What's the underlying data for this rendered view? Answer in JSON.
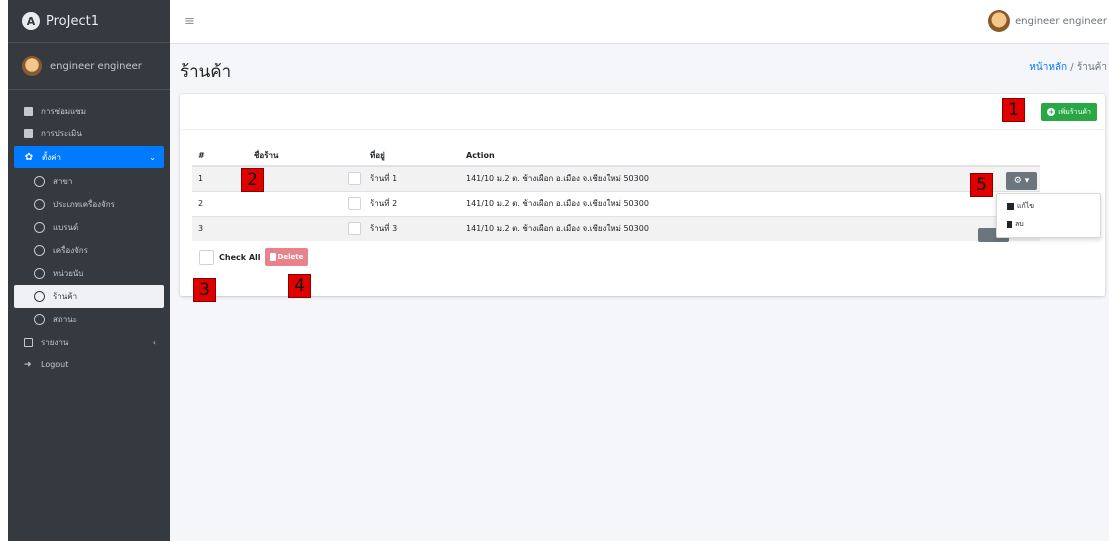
{
  "brand": {
    "name": "ProJect1",
    "logo_letter": "A"
  },
  "user": {
    "name": "engineer engineer"
  },
  "sidebar": {
    "items": [
      {
        "label": "การซ่อมแซม",
        "icon": "clipboard-icon"
      },
      {
        "label": "การประเมิน",
        "icon": "check-square-icon"
      }
    ],
    "active": {
      "label": "ตั้งค่า",
      "icon": "gear-icon",
      "chevron": "⌄"
    },
    "sub_items": [
      {
        "label": "สาขา"
      },
      {
        "label": "ประเภทเครื่องจักร"
      },
      {
        "label": "แบรนด์"
      },
      {
        "label": "เครื่องจักร"
      },
      {
        "label": "หน่วยนับ"
      },
      {
        "label": "ร้านค้า",
        "selected": true
      },
      {
        "label": "สถานะ"
      }
    ],
    "report": {
      "label": "รายงาน",
      "icon": "report-icon",
      "chevron": "‹"
    },
    "logout": {
      "label": "Logout",
      "icon": "logout-icon"
    }
  },
  "topbar": {
    "hamburger": "≡",
    "user_name": "engineer engineer"
  },
  "page": {
    "title": "ร้านค้า"
  },
  "breadcrumb": {
    "home": "หน้าหลัก",
    "separator": "/",
    "current": "ร้านค้า"
  },
  "toolbar": {
    "add_label": "เพิ่มร้านค้า"
  },
  "table": {
    "columns": [
      "#",
      "ชื่อร้าน",
      "",
      "ที่อยู่",
      "Action"
    ],
    "rows": [
      {
        "no": "1",
        "name": "ร้านที่ 1",
        "address": "141/10 ม.2 ต. ช้างเผือก อ.เมือง จ.เชียงใหม่ 50300"
      },
      {
        "no": "2",
        "name": "ร้านที่ 2",
        "address": "141/10 ม.2 ต. ช้างเผือก อ.เมือง จ.เชียงใหม่ 50300"
      },
      {
        "no": "3",
        "name": "ร้านที่ 3",
        "address": "141/10 ม.2 ต. ช้างเผือก อ.เมือง จ.เชียงใหม่ 50300"
      }
    ]
  },
  "footer": {
    "check_all": "Check All",
    "delete_label": "Delete"
  },
  "dropdown": {
    "gear": "⚙ ▾",
    "edit": "แก้ไข",
    "delete": "ลบ"
  },
  "markers": [
    "1",
    "2",
    "3",
    "4",
    "5"
  ],
  "colors": {
    "sidebar": "#343a40",
    "primary": "#007bff",
    "success": "#28a745",
    "danger": "#e9838b",
    "marker": "#e00000"
  }
}
